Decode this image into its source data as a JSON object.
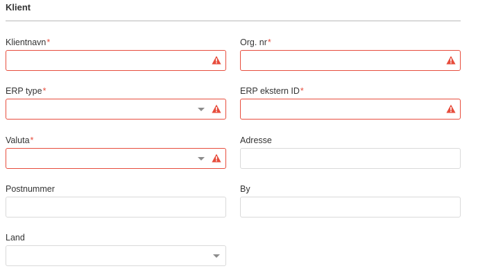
{
  "section": {
    "title": "Klient"
  },
  "fields": {
    "klientnavn": {
      "label": "Klientnavn",
      "required": "*",
      "value": ""
    },
    "org_nr": {
      "label": "Org. nr",
      "required": "*",
      "value": ""
    },
    "erp_type": {
      "label": "ERP type",
      "required": "*",
      "value": ""
    },
    "erp_ekstern_id": {
      "label": "ERP ekstern ID",
      "required": "*",
      "value": ""
    },
    "valuta": {
      "label": "Valuta",
      "required": "*",
      "value": ""
    },
    "adresse": {
      "label": "Adresse",
      "value": ""
    },
    "postnummer": {
      "label": "Postnummer",
      "value": ""
    },
    "by": {
      "label": "By",
      "value": ""
    },
    "land": {
      "label": "Land",
      "value": ""
    }
  },
  "colors": {
    "error": "#e74c3c",
    "border": "#d9d9d9",
    "caret": "#8c8c8c",
    "text": "#333333"
  },
  "icons": {
    "warning": "warning-icon",
    "dropdown": "chevron-down-icon"
  }
}
